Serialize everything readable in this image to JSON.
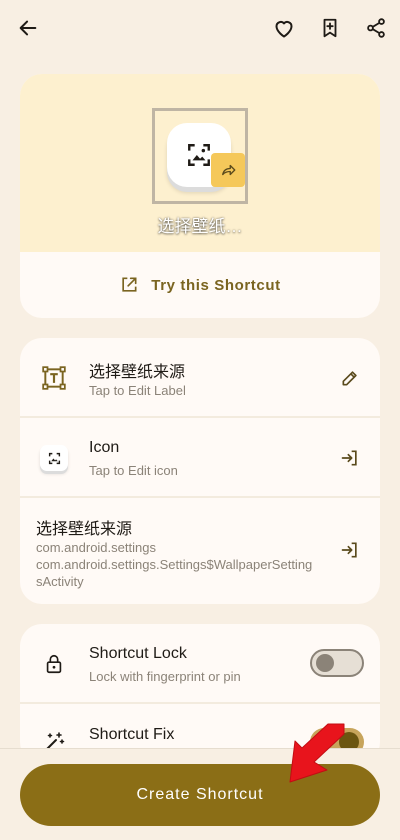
{
  "topbar": {
    "back_icon": "arrow-left-icon",
    "favorite_icon": "heart-icon",
    "bookmark_icon": "bookmark-add-icon",
    "share_icon": "share-icon"
  },
  "preview": {
    "shortcut_name": "选择壁纸…",
    "try_label": "Try this Shortcut"
  },
  "info": {
    "label_row": {
      "title": "选择壁纸来源",
      "subtitle": "Tap to Edit Label"
    },
    "icon_row": {
      "title": "Icon",
      "subtitle": "Tap to Edit icon"
    },
    "activity_row": {
      "title": "选择壁纸来源",
      "line1": "com.android.settings",
      "line2": "com.android.settings.Settings$WallpaperSetting",
      "line3": "sActivity"
    }
  },
  "settings": {
    "lock": {
      "title": "Shortcut Lock",
      "subtitle": "Lock with fingerprint or pin",
      "enabled": false
    },
    "fix": {
      "title": "Shortcut Fix",
      "enabled": true
    }
  },
  "create_button": {
    "label": "Create Shortcut"
  },
  "colors": {
    "background": "#f8efe3",
    "accent": "#8b6e16",
    "preview_header": "#fdf0cf",
    "badge": "#f5c85a",
    "annotation_arrow": "#e8141c"
  }
}
